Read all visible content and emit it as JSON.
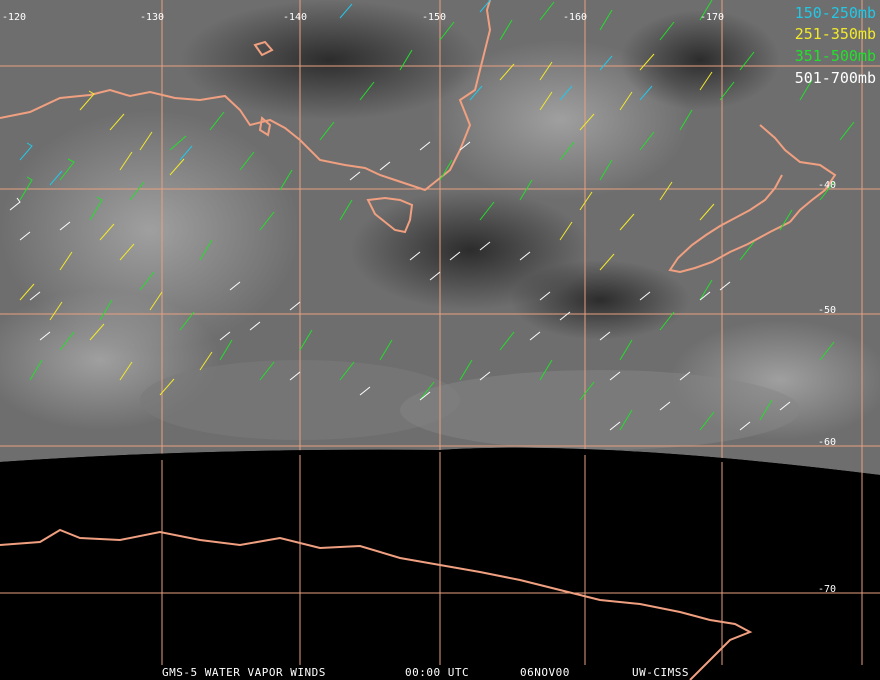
{
  "legend": [
    {
      "label": "150-250mb",
      "color": "#22c8e6"
    },
    {
      "label": "251-350mb",
      "color": "#f2ea2a"
    },
    {
      "label": "351-500mb",
      "color": "#22e02a"
    },
    {
      "label": "501-700mb",
      "color": "#ffffff"
    }
  ],
  "longitude_labels": [
    "-120",
    "-130",
    "-140",
    "-150",
    "-160",
    "-170"
  ],
  "latitude_labels": [
    "-40",
    "-50",
    "-60",
    "-70"
  ],
  "footer": {
    "product": "GMS-5 WATER VAPOR WINDS",
    "time": "00:00 UTC",
    "date": "06NOV00",
    "source": "UW-CIMSS"
  },
  "colors": {
    "coastline": "#f0a080",
    "grid": "#e8a080",
    "background": "#000000"
  }
}
